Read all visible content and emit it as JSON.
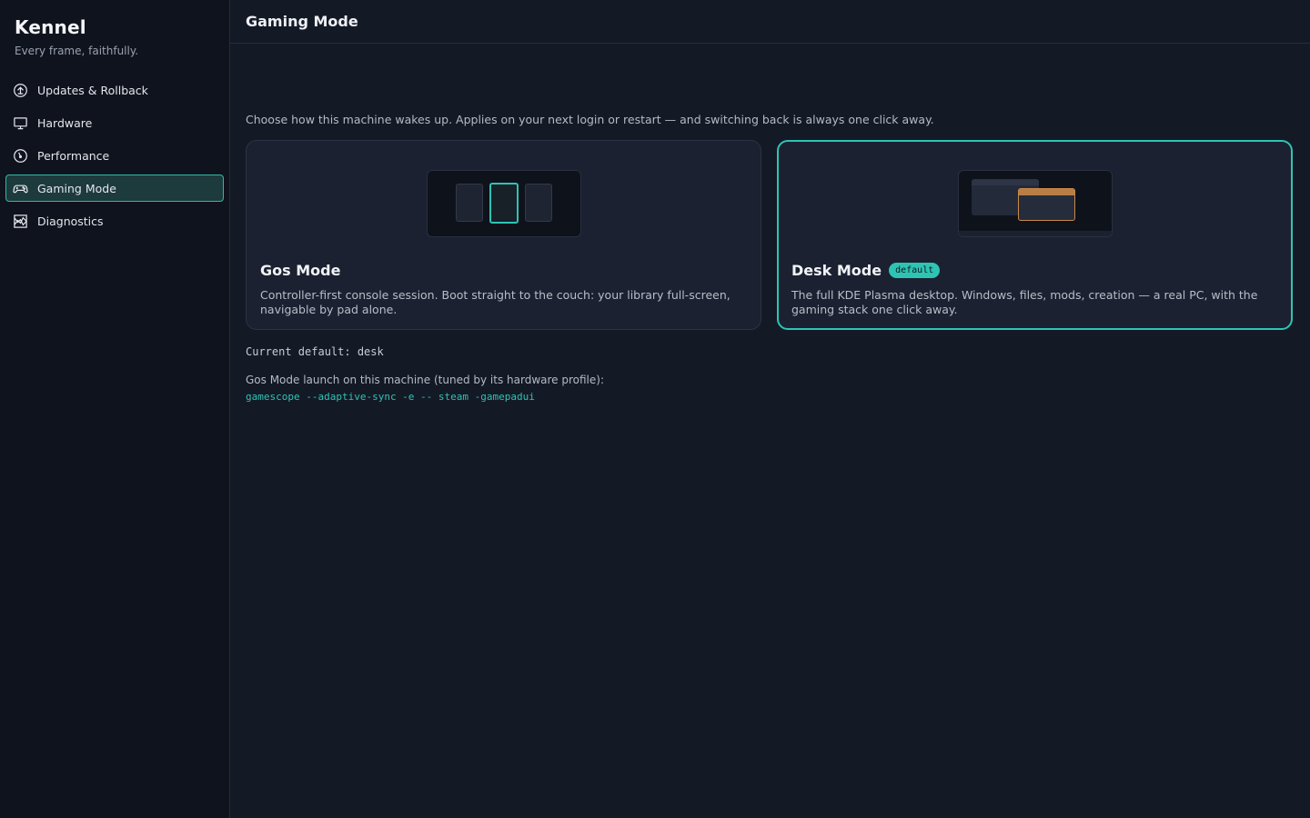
{
  "brand": {
    "title": "Kennel",
    "tagline": "Every frame, faithfully."
  },
  "sidebar": {
    "items": [
      {
        "label": "Updates & Rollback",
        "icon": "update-arrow-icon",
        "active": false
      },
      {
        "label": "Hardware",
        "icon": "monitor-icon",
        "active": false
      },
      {
        "label": "Performance",
        "icon": "gauge-icon",
        "active": false
      },
      {
        "label": "Gaming Mode",
        "icon": "gamepad-icon",
        "active": true
      },
      {
        "label": "Diagnostics",
        "icon": "diagnostics-chart-icon",
        "active": false
      }
    ]
  },
  "header": {
    "title": "Gaming Mode"
  },
  "main": {
    "intro": "Choose how this machine wakes up. Applies on your next login or restart — and switching back is always one click away.",
    "cards": [
      {
        "title": "Gos Mode",
        "description": "Controller-first console session. Boot straight to the couch: your library full-screen, navigable by pad alone.",
        "selected": false
      },
      {
        "title": "Desk Mode",
        "badge": "default",
        "description": "The full KDE Plasma desktop. Windows, files, mods, creation — a real PC, with the gaming stack one click away.",
        "selected": true
      }
    ],
    "current_default": "Current default: desk",
    "launch_label": "Gos Mode launch on this machine (tuned by its hardware profile):",
    "launch_command": "gamescope --adaptive-sync -e -- steam -gamepadui"
  },
  "colors": {
    "accent": "#2ec4b4",
    "window_highlight": "#c98a4a",
    "background": "#141926",
    "sidebar_background": "#0f131d"
  }
}
